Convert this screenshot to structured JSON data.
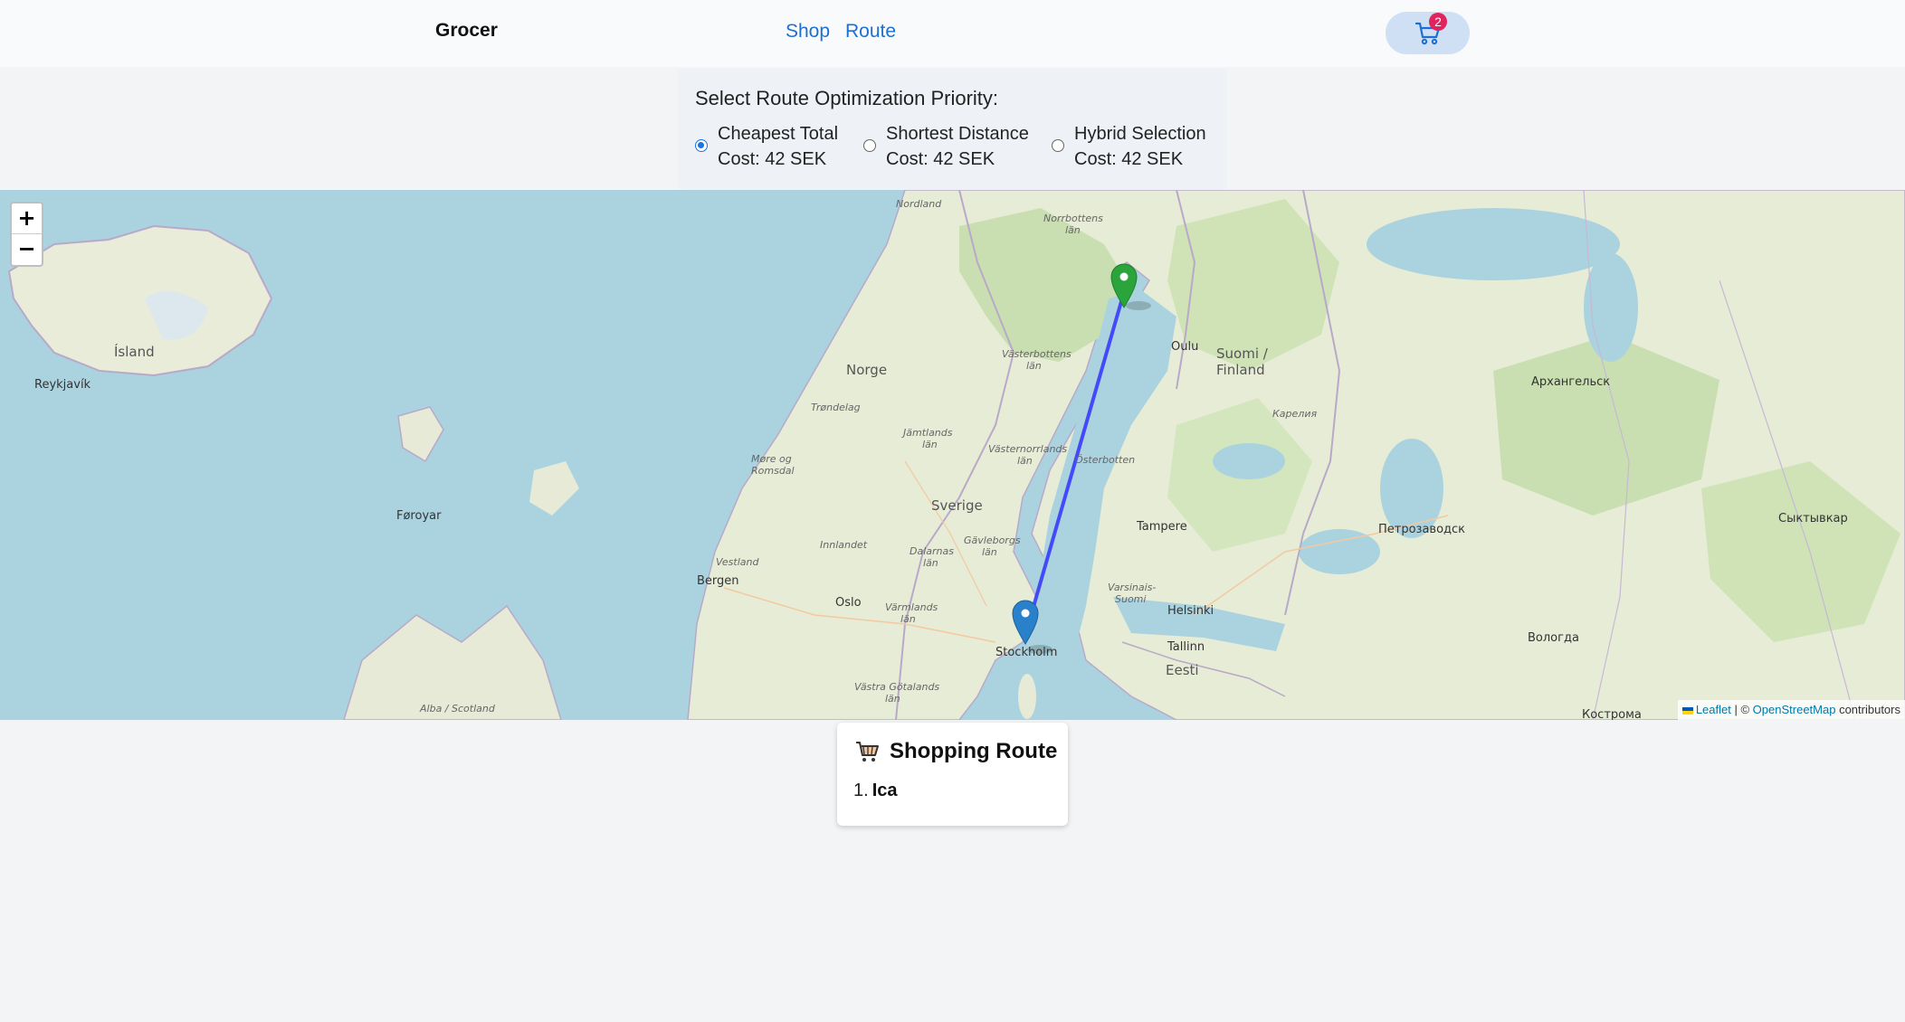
{
  "nav": {
    "brand": "Grocer",
    "links": [
      {
        "label": "Shop"
      },
      {
        "label": "Route"
      }
    ],
    "cart": {
      "icon": "cart-icon",
      "count": "2"
    }
  },
  "priority": {
    "title": "Select Route Optimization Priority:",
    "options": [
      {
        "label": "Cheapest Total",
        "cost": "Cost: 42 SEK",
        "selected": true
      },
      {
        "label": "Shortest Distance",
        "cost": "Cost: 42 SEK",
        "selected": false
      },
      {
        "label": "Hybrid Selection",
        "cost": "Cost: 42 SEK",
        "selected": false
      }
    ]
  },
  "map": {
    "zoom_in": "+",
    "zoom_out": "−",
    "attribution": {
      "leaflet": "Leaflet",
      "sep": " | © ",
      "osm": "OpenStreetMap",
      "contributors": " contributors"
    },
    "places": {
      "island": "Ísland",
      "reykjavik": "Reykjavík",
      "norge": "Norge",
      "sverige": "Sverige",
      "suomi": "Suomi /",
      "finland": "Finland",
      "foroyar": "Føroyar",
      "bergen": "Bergen",
      "oslo": "Oslo",
      "stockholm": "Stockholm",
      "helsinki": "Helsinki",
      "tallinn": "Tallinn",
      "eesti": "Eesti",
      "tampere": "Tampere",
      "oulu": "Oulu",
      "arkhangelsk": "Архангельск",
      "petrozavodsk": "Петрозаводск",
      "syktyvkar": "Сыктывкар",
      "vologda": "Вологда",
      "kostroma": "Кострома",
      "nordland": "Nordland",
      "norrbotten": "Norrbottens",
      "norrbotten2": "län",
      "vasterbotten": "Västerbottens",
      "vasterbotten2": "län",
      "trondelag": "Trøndelag",
      "jamtland": "Jämtlands",
      "jamtland2": "län",
      "vasternorrland": "Västernorrlands",
      "vasternorrland2": "län",
      "more": "Møre og",
      "more2": "Romsdal",
      "innlandet": "Innlandet",
      "vestland": "Vestland",
      "gavleborg": "Gävleborgs",
      "gavleborg2": "län",
      "dalarna": "Dalarnas",
      "dalarna2": "län",
      "varmland": "Värmlands",
      "varmland2": "län",
      "vastra": "Västra Götalands",
      "vastra2": "län",
      "osterbotten": "Österbotten",
      "karelia": "Карелия",
      "alba": "Alba / Scotland",
      "varsinais": "Varsinais-",
      "varsinais2": "Suomi"
    },
    "markers": [
      {
        "name": "start",
        "color": "#2aa43b"
      },
      {
        "name": "stockholm",
        "color": "#2a81cb"
      }
    ],
    "route_color": "#3333ff"
  },
  "route_card": {
    "title": "Shopping Route",
    "icon": "shopping-cart-icon",
    "items": [
      {
        "num": "1.",
        "name": "Ica"
      }
    ]
  }
}
